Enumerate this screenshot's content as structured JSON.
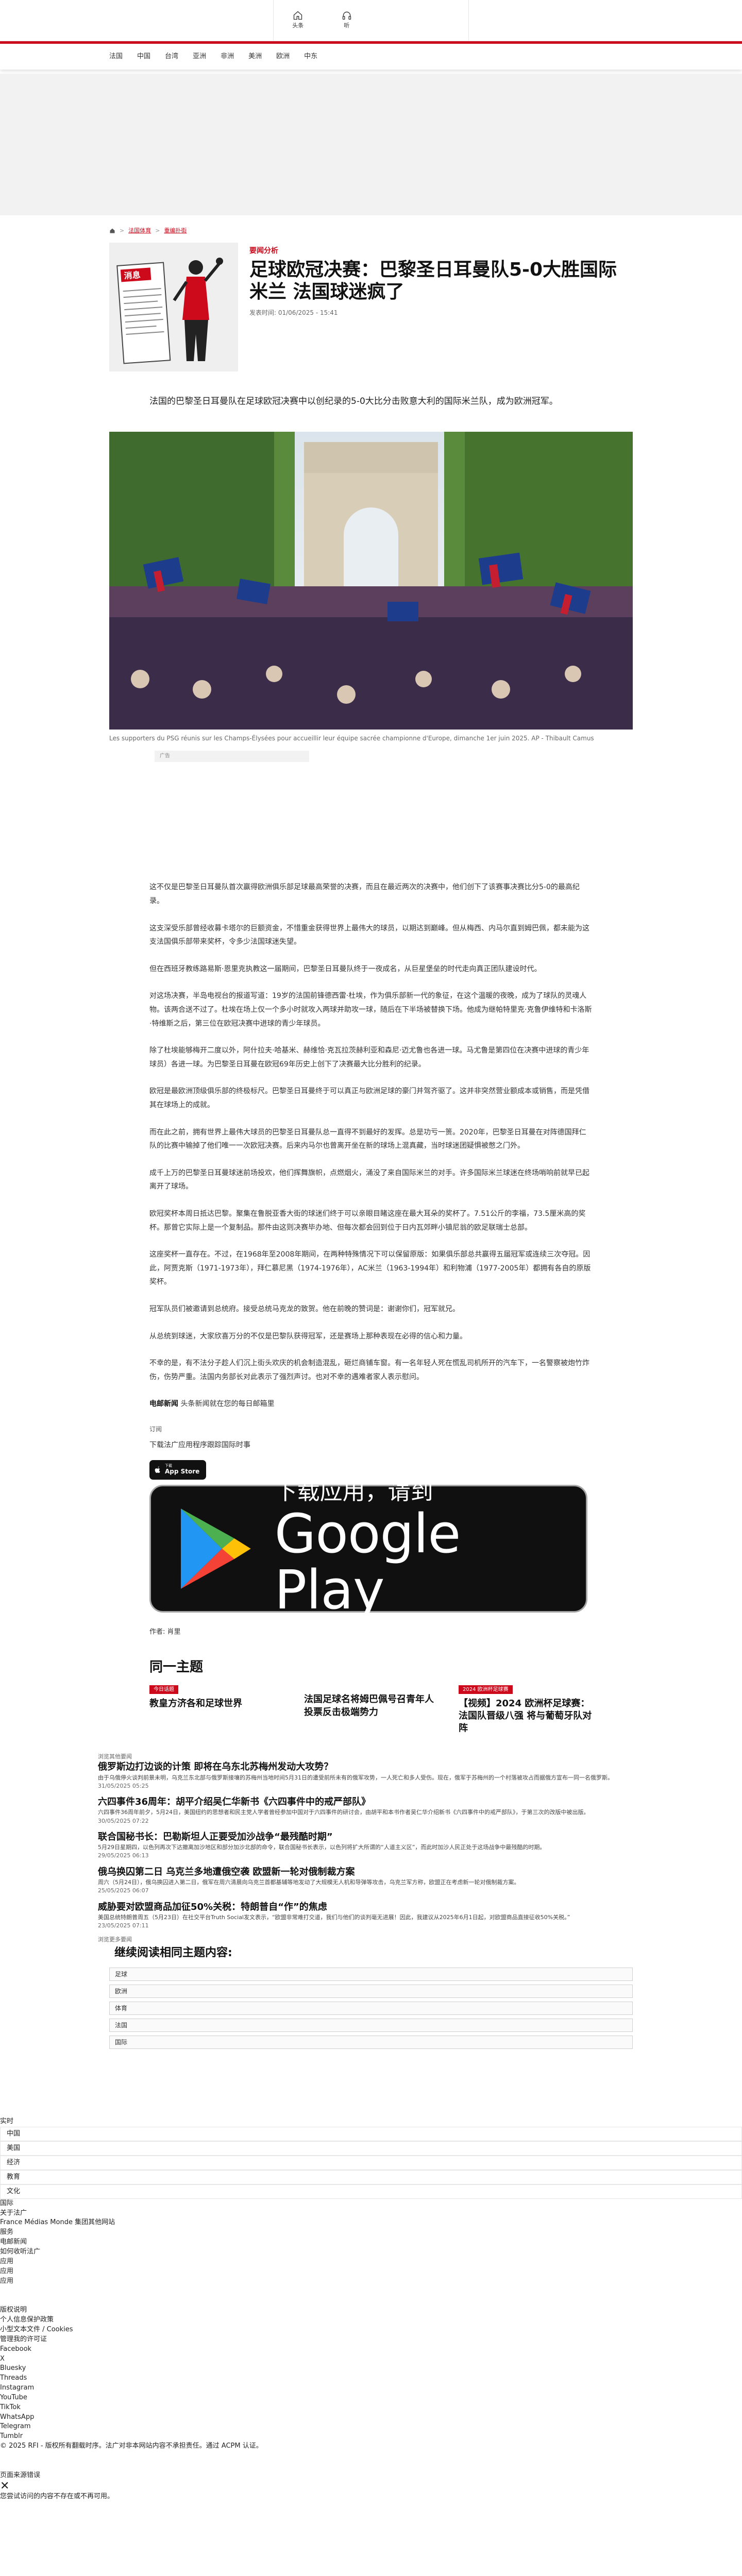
{
  "topnav": {
    "home": "头条",
    "listen": "听"
  },
  "categories": [
    "法国",
    "中国",
    "台湾",
    "亚洲",
    "非洲",
    "美洲",
    "欧洲",
    "中东"
  ],
  "breadcrumb": [
    "法国体育",
    "重编扑街"
  ],
  "article": {
    "kicker": "要闻分析",
    "title": "足球欧冠决赛：巴黎圣日耳曼队5-0大胜国际米兰 法国球迷疯了",
    "pubdate": "发表时间: 01/06/2025 - 15:41",
    "illustration_sign": "消息",
    "lead": "法国的巴黎圣日耳曼队在足球欧冠决赛中以创纪录的5-0大比分击败意大利的国际米兰队，成为欧洲冠军。",
    "caption": "Les supporters du PSG réunis sur les Champs-Élysées pour accueillir leur équipe sacrée championne d'Europe, dimanche 1er juin 2025. AP - Thibault Camus",
    "ad_label": "广告",
    "paragraphs": [
      "这不仅是巴黎圣日耳曼队首次赢得欧洲俱乐部足球最高荣誉的决赛，而且在最近两次的决赛中，他们创下了该赛事决赛比分5-0的最高纪录。",
      "这支深受乐部曾经收募卡塔尔的巨额资金，不惜重金获得世界上最伟大的球员，以期达到巅峰。但从梅西、内马尔直到姆巴佩，都未能为这支法国俱乐部带来奖杯，令多少法国球迷失望。",
      "但在西班牙教练路易斯·恩里克执教这一届期间，巴黎圣日耳曼队终于一夜成名，从巨星堡垒的时代走向真正团队建设时代。",
      "对这场决赛，半岛电视台的报道写道：19岁的法国前锋德西雷·杜埃，作为俱乐部新一代的象征，在这个温暖的夜晚，成为了球队的灵魂人物。该两合送不过了。杜埃在场上仅一个多小时就攻入两球并助攻一球，随后在下半场被替换下场。他成为继帕特里克·克鲁伊维特和卡洛斯·特维斯之后，第三位在欧冠决赛中进球的青少年球员。",
      "除了杜埃能够梅开二度以外，阿什拉夫·哈基米、赫维恰·克瓦拉茨赫利亚和森尼·迈尤鲁也各进一球。马尤鲁是第四位在决赛中进球的青少年球员）各进一球。为巴黎圣日耳曼在欧冠69年历史上创下了决赛最大比分胜利的纪录。",
      "欧冠是最欧洲顶级俱乐部的终极标尺。巴黎圣日耳曼终于可以真正与欧洲足球的豪门并驾齐驱了。这并非突然营业额成本或销售，而是凭借其在球场上的成就。",
      "而在此之前，拥有世界上最伟大球员的巴黎圣日耳曼队总一直得不到最好的发挥。总是功亏一篑。2020年，巴黎圣日耳曼在对阵德国拜仁队的比赛中输掉了他们唯一一次欧冠决赛。后来内马尔也曾离开坐在新的球场上混真藏，当时球迷团疑惧被憋之门外。",
      "成千上万的巴黎圣日耳曼球迷前场投欢，他们挥舞旗帜，点燃烟火，涌没了来自国际米兰的对手。许多国际米兰球迷在终场哨响前就早已起离开了球场。",
      "欧冠奖杯本周日抵达巴黎。聚集在鲁脱亚香大街的球迷们终于可以亲眼目睹这座在最大耳朵的奖杯了。7.51公斤的李福，73.5厘米高的奖杯。那曾它实际上是一个复制品。那件由这则决赛毕办地、但每次都会回到位于日内瓦郊畔小镇尼翁的欧足联瑞士总部。",
      "这座奖杯一直存在。不过，在1968年至2008年期间，在两种特殊情况下可以保留原版：如果俱乐部总共赢得五届冠军或连续三次夺冠。因此，阿贾克斯（1971-1973年），拜仁慕尼黑（1974-1976年），AC米兰（1963-1994年）和利物浦（1977-2005年）都拥有各自的原版奖杯。",
      "冠军队员们被邀请到总统府。接受总统马克龙的致贺。他在前晚的赞词是：谢谢你们，冠军就兄。",
      "从总统到球迷，大家欣喜万分的不仅是巴黎队获得冠军，还是赛场上那种表现在必得的信心和力量。",
      "不幸的是，有不法分子趁人们沉上街头欢庆的机会制造混乱，砸烂商铺车窗。有一名年轻人死在慌乱司机所开的汽车下，一名警察被炮竹炸伤，伤势严重。法国内务部长对此表示了强烈声讨。也对不幸的遇难者家人表示慰问。"
    ],
    "signoff_bold": "电邮新闻",
    "signoff_rest": "头条新闻就在您的每日邮箱里",
    "subscribe": "订阅",
    "download_text": "下载法广应用程序跟踪国际时事",
    "appstore_small": "下载",
    "appstore_big": "App Store",
    "gplay_line1": "下载应用，请到",
    "gplay_line2": "Google Play",
    "author": "作者: 肖里"
  },
  "related": {
    "heading": "同一主题",
    "items": [
      {
        "badge": "今日话题",
        "title": "教皇方济各和足球世界"
      },
      {
        "badge": "",
        "title": "法国足球名将姆巴佩号召青年人投票反击极端势力"
      },
      {
        "badge": "2024 欧洲杯足球赛",
        "title": "【视频】2024 欧洲杯足球赛：法国队晋级八强 将与葡萄牙队对阵"
      }
    ]
  },
  "news": {
    "kicker": "浏览其他要闻",
    "items": [
      {
        "title": "俄罗斯边打边谈的计策 即将在乌东北苏梅州发动大攻势？",
        "summary": "由于乌俄停火谈判前景未明，乌克兰东北部与俄罗斯接壤的苏梅州当地时间5月31日的遭受前所未有的俄军攻势，一人死亡和多人受伤。现在，俄军于苏梅州的一个村落被攻占而据俄方宣布一同一名俄罗斯。",
        "date": "31/05/2025 05:25"
      },
      {
        "title": "六四事件36周年：胡平介绍吴仁华新书《六四事件中的戒严部队》",
        "summary": "六四事件36周年前夕，5月24日，美国纽约的思想者和民主党人学者曾经参加中国对于六四事件的研讨会，由胡平和本书作者吴仁华介绍新书《六四事件中的戒严部队》，于第三次的改版中被出版。",
        "date": "30/05/2025 07:22"
      },
      {
        "title": "联合国秘书长：巴勒斯坦人正要受加沙战争“最残酷时期”",
        "summary": "5月29日星期四，以色列再次下达撤离加沙地区和部分加沙北部的命令，联合国秘书长表示，以色列将扩大所谓的“人道主义区”，而此时加沙人民正处于这场战争中最残酷的时期。",
        "date": "29/05/2025 06:13"
      },
      {
        "title": "俄乌换囚第二日 乌克兰多地遭俄空袭 欧盟新一轮对俄制裁方案",
        "summary": "周六（5月24日），俄乌换囚进入第二日，俄军在周六清晨向乌克兰首都基辅等地发动了大规模无人机和导弹等攻击，乌克兰军方称，欧盟正在考虑新一轮对俄制裁方案。",
        "date": "25/05/2025 06:07"
      },
      {
        "title": "威胁要对欧盟商品加征50%关税：特朗普自“作”的焦虑",
        "summary": "美国总统特朗普周五（5月23日）在社交平台Truth Social发文表示，“欧盟非常难打交道，我们与他们的谈判毫无进展！因此，我建议从2025年6月1日起，对欧盟商品直接征收50%关税。”",
        "date": "23/05/2025 07:11"
      }
    ]
  },
  "more": {
    "small": "浏览更多要闻",
    "heading": "继续阅读相同主题内容:",
    "items": [
      "足球",
      "欧洲",
      "体育",
      "法国",
      "国际"
    ]
  },
  "footer": {
    "realtime": "实时",
    "boxes": [
      "中国",
      "美国",
      "经济",
      "教育",
      "文化"
    ],
    "lines": [
      "国际",
      "关于法广",
      "France Médias Monde 集团其他网站",
      "服务",
      "电邮新闻",
      "如何收听法广",
      "应用",
      "应用",
      "应用"
    ],
    "legal": [
      "版权说明",
      "个人信息保护政策",
      "小型文本文件 / Cookies",
      "管理我的许可证"
    ],
    "social": [
      "Facebook",
      "X",
      "Bluesky",
      "Threads",
      "Instagram",
      "YouTube",
      "TikTok",
      "WhatsApp",
      "Telegram",
      "Tumblr"
    ],
    "copyright": "© 2025 RFI - 版权所有翻载时序。法广对非本网站内容不承担责任。通过 ACPM 认证。",
    "blocked": "页面来源错误",
    "close": "✕",
    "notice": "您尝试访问的内容不存在或不再可用。"
  }
}
